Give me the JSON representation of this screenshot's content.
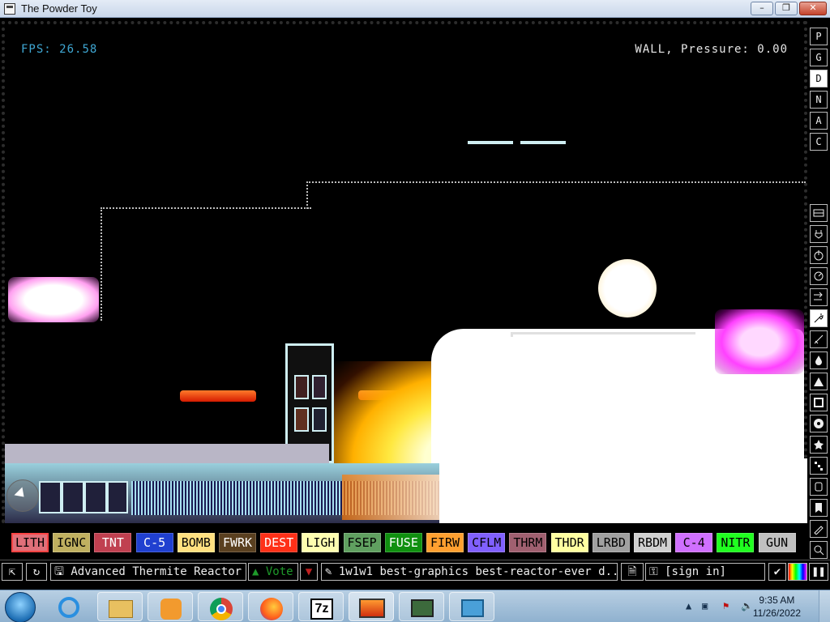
{
  "window": {
    "title": "The Powder Toy"
  },
  "hud": {
    "fps_label": "FPS:",
    "fps_value": "26.58",
    "status": "WALL, Pressure: 0.00"
  },
  "right_toolbar": {
    "menu_letters": [
      "P",
      "G",
      "D",
      "N",
      "A",
      "C"
    ],
    "selected_letter": "D",
    "categories": [
      "walls-icon",
      "electronics-icon",
      "powered-icon",
      "sensors-icon",
      "force-icon",
      "explosives-icon",
      "gases-icon",
      "liquids-icon",
      "powders-icon",
      "solids-icon",
      "radioactive-icon",
      "special-icon",
      "life-icon",
      "tools-icon",
      "favorites-icon",
      "decoration-icon",
      "search-icon"
    ],
    "selected_category": "explosives-icon"
  },
  "palette": {
    "elements": [
      {
        "label": "LITH",
        "bg": "#e0707a",
        "fg": "#000000"
      },
      {
        "label": "IGNC",
        "bg": "#c0b060",
        "fg": "#000000"
      },
      {
        "label": "TNT",
        "bg": "#c04050",
        "fg": "#ffffff"
      },
      {
        "label": "C-5",
        "bg": "#2040d0",
        "fg": "#ffffff"
      },
      {
        "label": "BOMB",
        "bg": "#ffe080",
        "fg": "#000000"
      },
      {
        "label": "FWRK",
        "bg": "#5a4020",
        "fg": "#ffffff"
      },
      {
        "label": "DEST",
        "bg": "#ff3018",
        "fg": "#ffffff"
      },
      {
        "label": "LIGH",
        "bg": "#ffffb0",
        "fg": "#000000"
      },
      {
        "label": "FSEP",
        "bg": "#60a060",
        "fg": "#000000"
      },
      {
        "label": "FUSE",
        "bg": "#109010",
        "fg": "#ffffff"
      },
      {
        "label": "FIRW",
        "bg": "#ffa030",
        "fg": "#000000"
      },
      {
        "label": "CFLM",
        "bg": "#8060ff",
        "fg": "#000000"
      },
      {
        "label": "THRM",
        "bg": "#a06070",
        "fg": "#000000"
      },
      {
        "label": "THDR",
        "bg": "#ffffa0",
        "fg": "#000000"
      },
      {
        "label": "LRBD",
        "bg": "#a0a0a0",
        "fg": "#000000"
      },
      {
        "label": "RBDM",
        "bg": "#d0d0d0",
        "fg": "#000000"
      },
      {
        "label": "C-4",
        "bg": "#d070ff",
        "fg": "#000000"
      },
      {
        "label": "NITR",
        "bg": "#20ff20",
        "fg": "#000000"
      },
      {
        "label": "GUN",
        "bg": "#c0c0c0",
        "fg": "#000000"
      }
    ],
    "selected": "LITH"
  },
  "bottom_bar": {
    "save_title": "Advanced Thermite Reactor",
    "vote_label": "Vote",
    "tags": "1w1w1 best-graphics best-reactor-ever d...",
    "sign_in": "[sign in]"
  },
  "taskbar": {
    "apps": [
      "internet-explorer-icon",
      "file-explorer-icon",
      "media-player-icon",
      "chrome-icon",
      "firefox-icon",
      "7zip-icon",
      "powder-toy-icon",
      "notes-icon",
      "control-panel-icon"
    ],
    "time": "9:35 AM",
    "date": "11/26/2022"
  }
}
